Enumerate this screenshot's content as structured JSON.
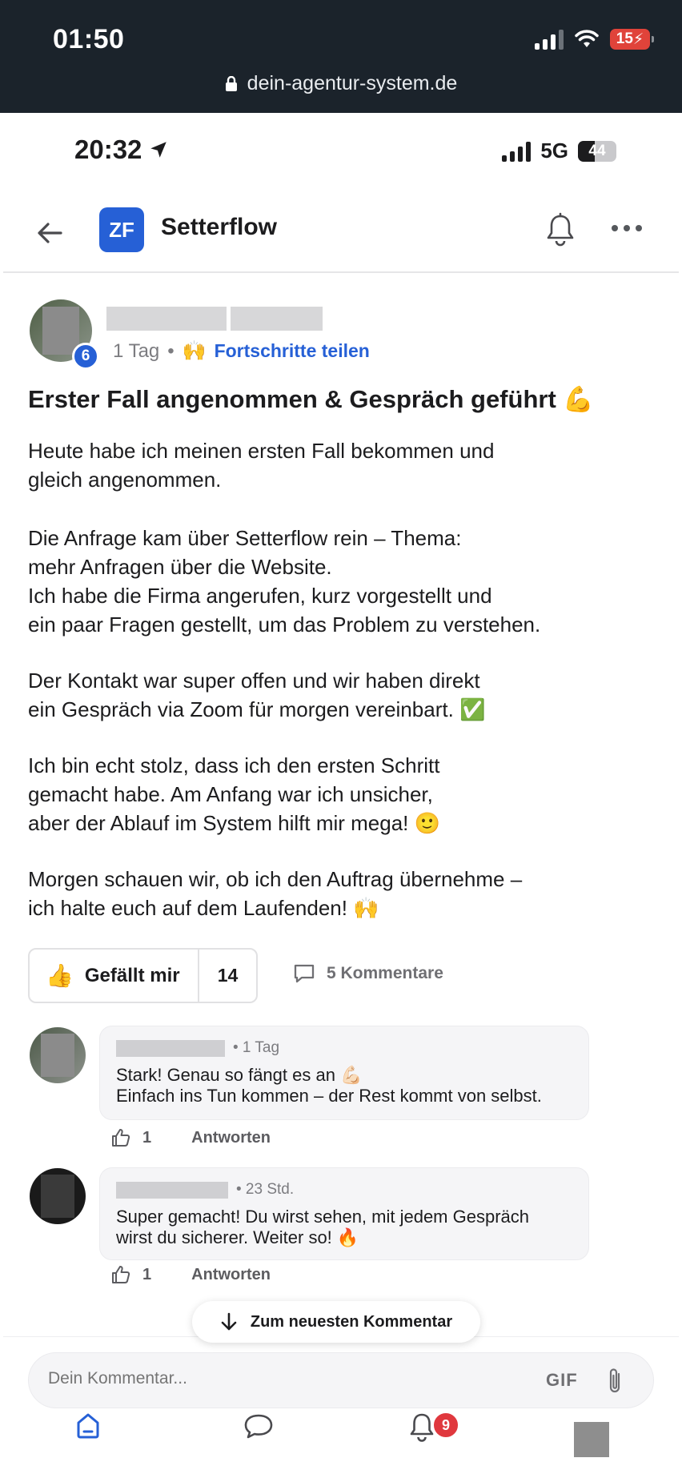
{
  "outer": {
    "time": "01:50",
    "battery": "15",
    "url": "dein-agentur-system.de"
  },
  "inner_status": {
    "time": "20:32",
    "network": "5G",
    "battery": "44"
  },
  "header": {
    "logo_text": "ZF",
    "title": "Setterflow"
  },
  "post": {
    "level": "6",
    "age": "1 Tag",
    "separator": "•",
    "category_emoji": "🙌",
    "category": "Fortschritte teilen",
    "title": "Erster Fall angenommen & Gespräch geführt 💪",
    "paragraphs": [
      "Heute habe ich meinen ersten Fall bekommen und\ngleich angenommen.",
      "Die Anfrage kam über Setterflow rein – Thema:\nmehr Anfragen über die Website.\nIch habe die Firma angerufen, kurz vorgestellt und\nein paar Fragen gestellt, um das Problem zu verstehen.",
      "Der Kontakt war super offen und wir haben direkt\nein Gespräch via Zoom für morgen vereinbart. ✅",
      "Ich bin echt stolz, dass ich den ersten Schritt\ngemacht habe. Am Anfang war ich unsicher,\naber der Ablauf im System hilft mir mega! 🙂",
      "Morgen schauen wir, ob ich den Auftrag übernehme –\nich halte euch auf dem Laufenden! 🙌"
    ],
    "like_label": "Gefällt mir",
    "like_count": "14",
    "comments_label": "5 Kommentare"
  },
  "comments": [
    {
      "meta": "• 1 Tag",
      "text": "Stark! Genau so fängt es an 💪🏻\nEinfach ins Tun kommen – der Rest kommt von selbst.",
      "likes": "1",
      "reply_label": "Antworten"
    },
    {
      "meta": "• 23 Std.",
      "text": "Super gemacht! Du wirst sehen, mit jedem Gespräch\nwirst du sicherer. Weiter so! 🔥",
      "likes": "1",
      "reply_label": "Antworten"
    }
  ],
  "jump_label": "Zum neuesten Kommentar",
  "composer": {
    "placeholder": "Dein Kommentar...",
    "gif_label": "GIF"
  },
  "tabbar": {
    "notification_count": "9"
  },
  "colors": {
    "accent": "#2660d6",
    "browser_bar": "#1b232b",
    "badge_red": "#e0383e"
  }
}
